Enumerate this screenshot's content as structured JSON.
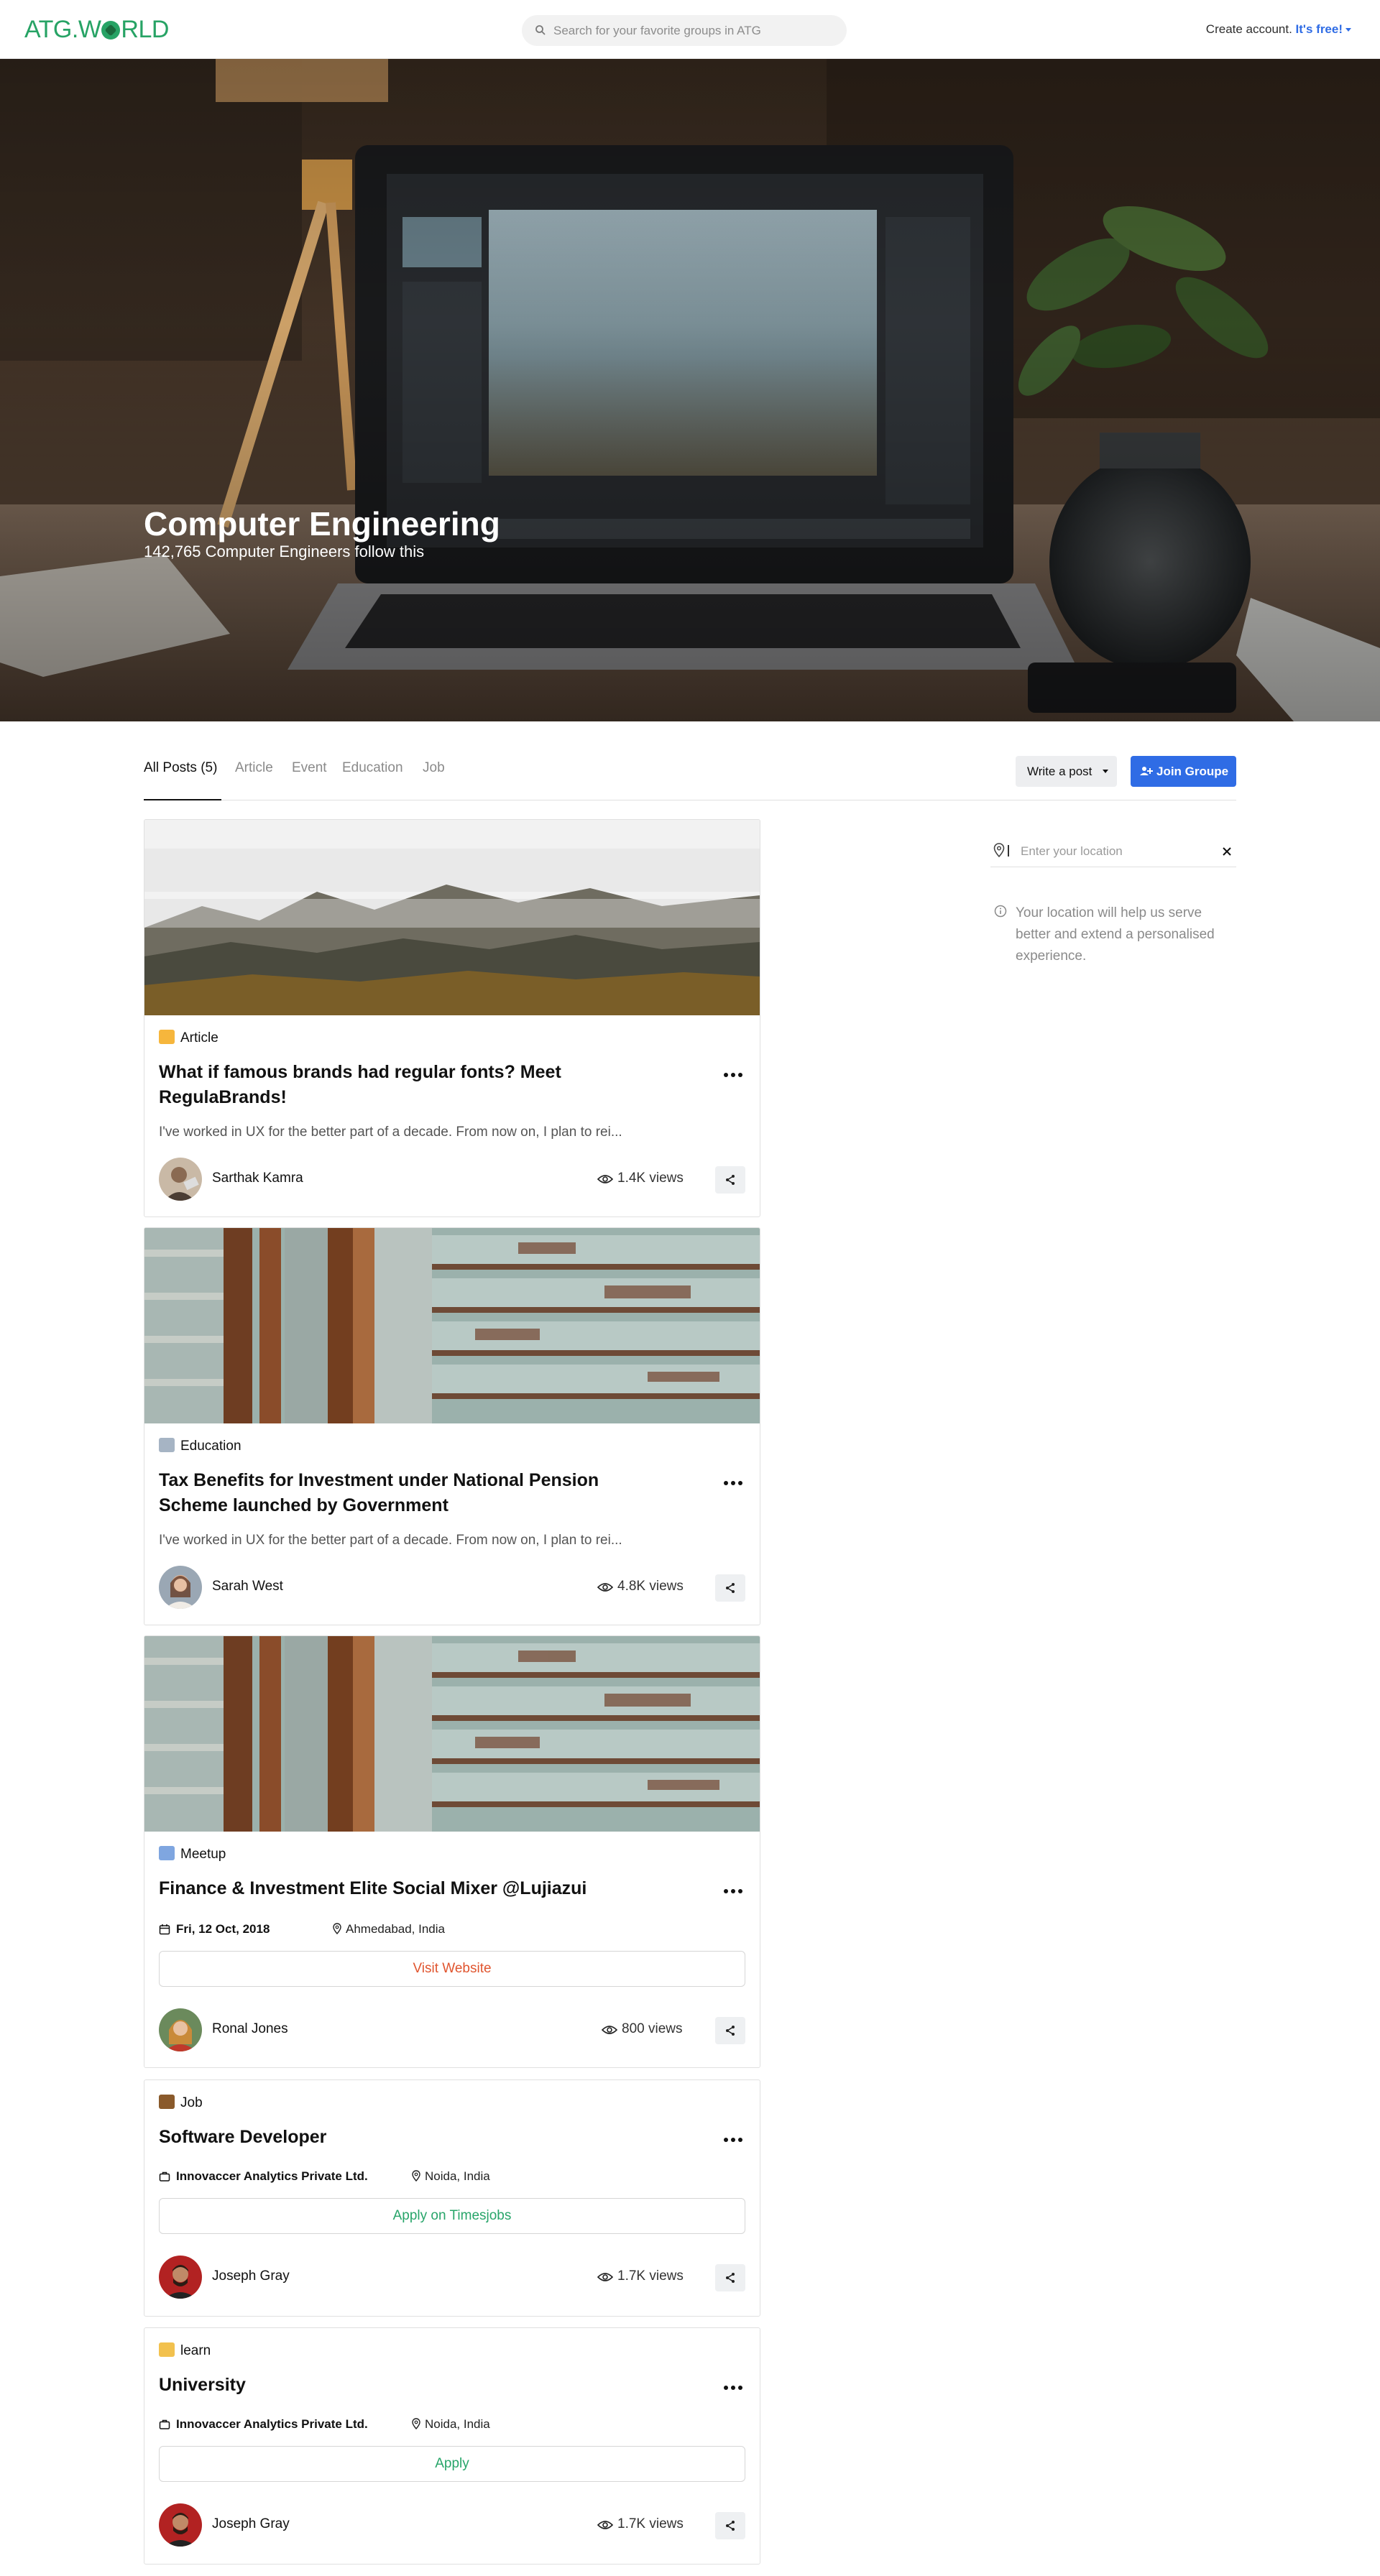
{
  "nav": {
    "logo_text_1": "ATG.W",
    "logo_text_2": "RLD",
    "search_placeholder": "Search for your favorite groups in ATG",
    "account_text": "Create account.",
    "account_free": "It's free!"
  },
  "hero": {
    "title": "Computer Engineering",
    "subtitle": "142,765 Computer Engineers follow this"
  },
  "tabs": {
    "items": [
      "All Posts (5)",
      "Article",
      "Event",
      "Education",
      "Job"
    ],
    "active": 0,
    "write_post": "Write a post",
    "join_group": "Join Groupe"
  },
  "sidebar": {
    "location_placeholder": "Enter your location",
    "location_note": "Your location will help us serve better and extend a personalised experience."
  },
  "posts": [
    {
      "category": "Article",
      "category_icon": "writing-hand-icon",
      "title": "What if famous brands had regular fonts? Meet RegulaBrands!",
      "excerpt": "I've worked in UX for the better part of a decade. From now on, I plan to rei...",
      "author": "Sarthak Kamra",
      "views": "1.4K views",
      "image": "misty-forest"
    },
    {
      "category": "Education",
      "category_icon": "microscope-icon",
      "title": "Tax Benefits for Investment under National Pension Scheme launched by Government",
      "excerpt": "I've worked in UX for the better part of a decade. From now on, I plan to rei...",
      "author": "Sarah West",
      "views": "4.8K views",
      "image": "peeling-paint-wall"
    },
    {
      "category": "Meetup",
      "category_icon": "calendar-icon",
      "title": "Finance & Investment Elite Social Mixer @Lujiazui",
      "date": "Fri, 12 Oct, 2018",
      "location": "Ahmedabad, India",
      "action": "Visit Website",
      "author": "Ronal Jones",
      "views": "800 views",
      "image": "peeling-paint-wall"
    },
    {
      "category": "Job",
      "category_icon": "briefcase-icon",
      "title": "Software Developer",
      "company": "Innovaccer Analytics Private Ltd.",
      "location": "Noida, India",
      "action": "Apply on Timesjobs",
      "author": "Joseph Gray",
      "views": "1.7K views"
    },
    {
      "category": "learn",
      "category_icon": "graduation-icon",
      "title": "University",
      "company": "Innovaccer Analytics Private Ltd.",
      "location": "Noida, India",
      "action": "Apply",
      "author": "Joseph Gray",
      "views": "1.7K views"
    }
  ],
  "colors": {
    "brand_green": "#27a365",
    "primary_blue": "#2f6ce5",
    "visit_red": "#e0552f",
    "apply_green": "#28a56a"
  }
}
